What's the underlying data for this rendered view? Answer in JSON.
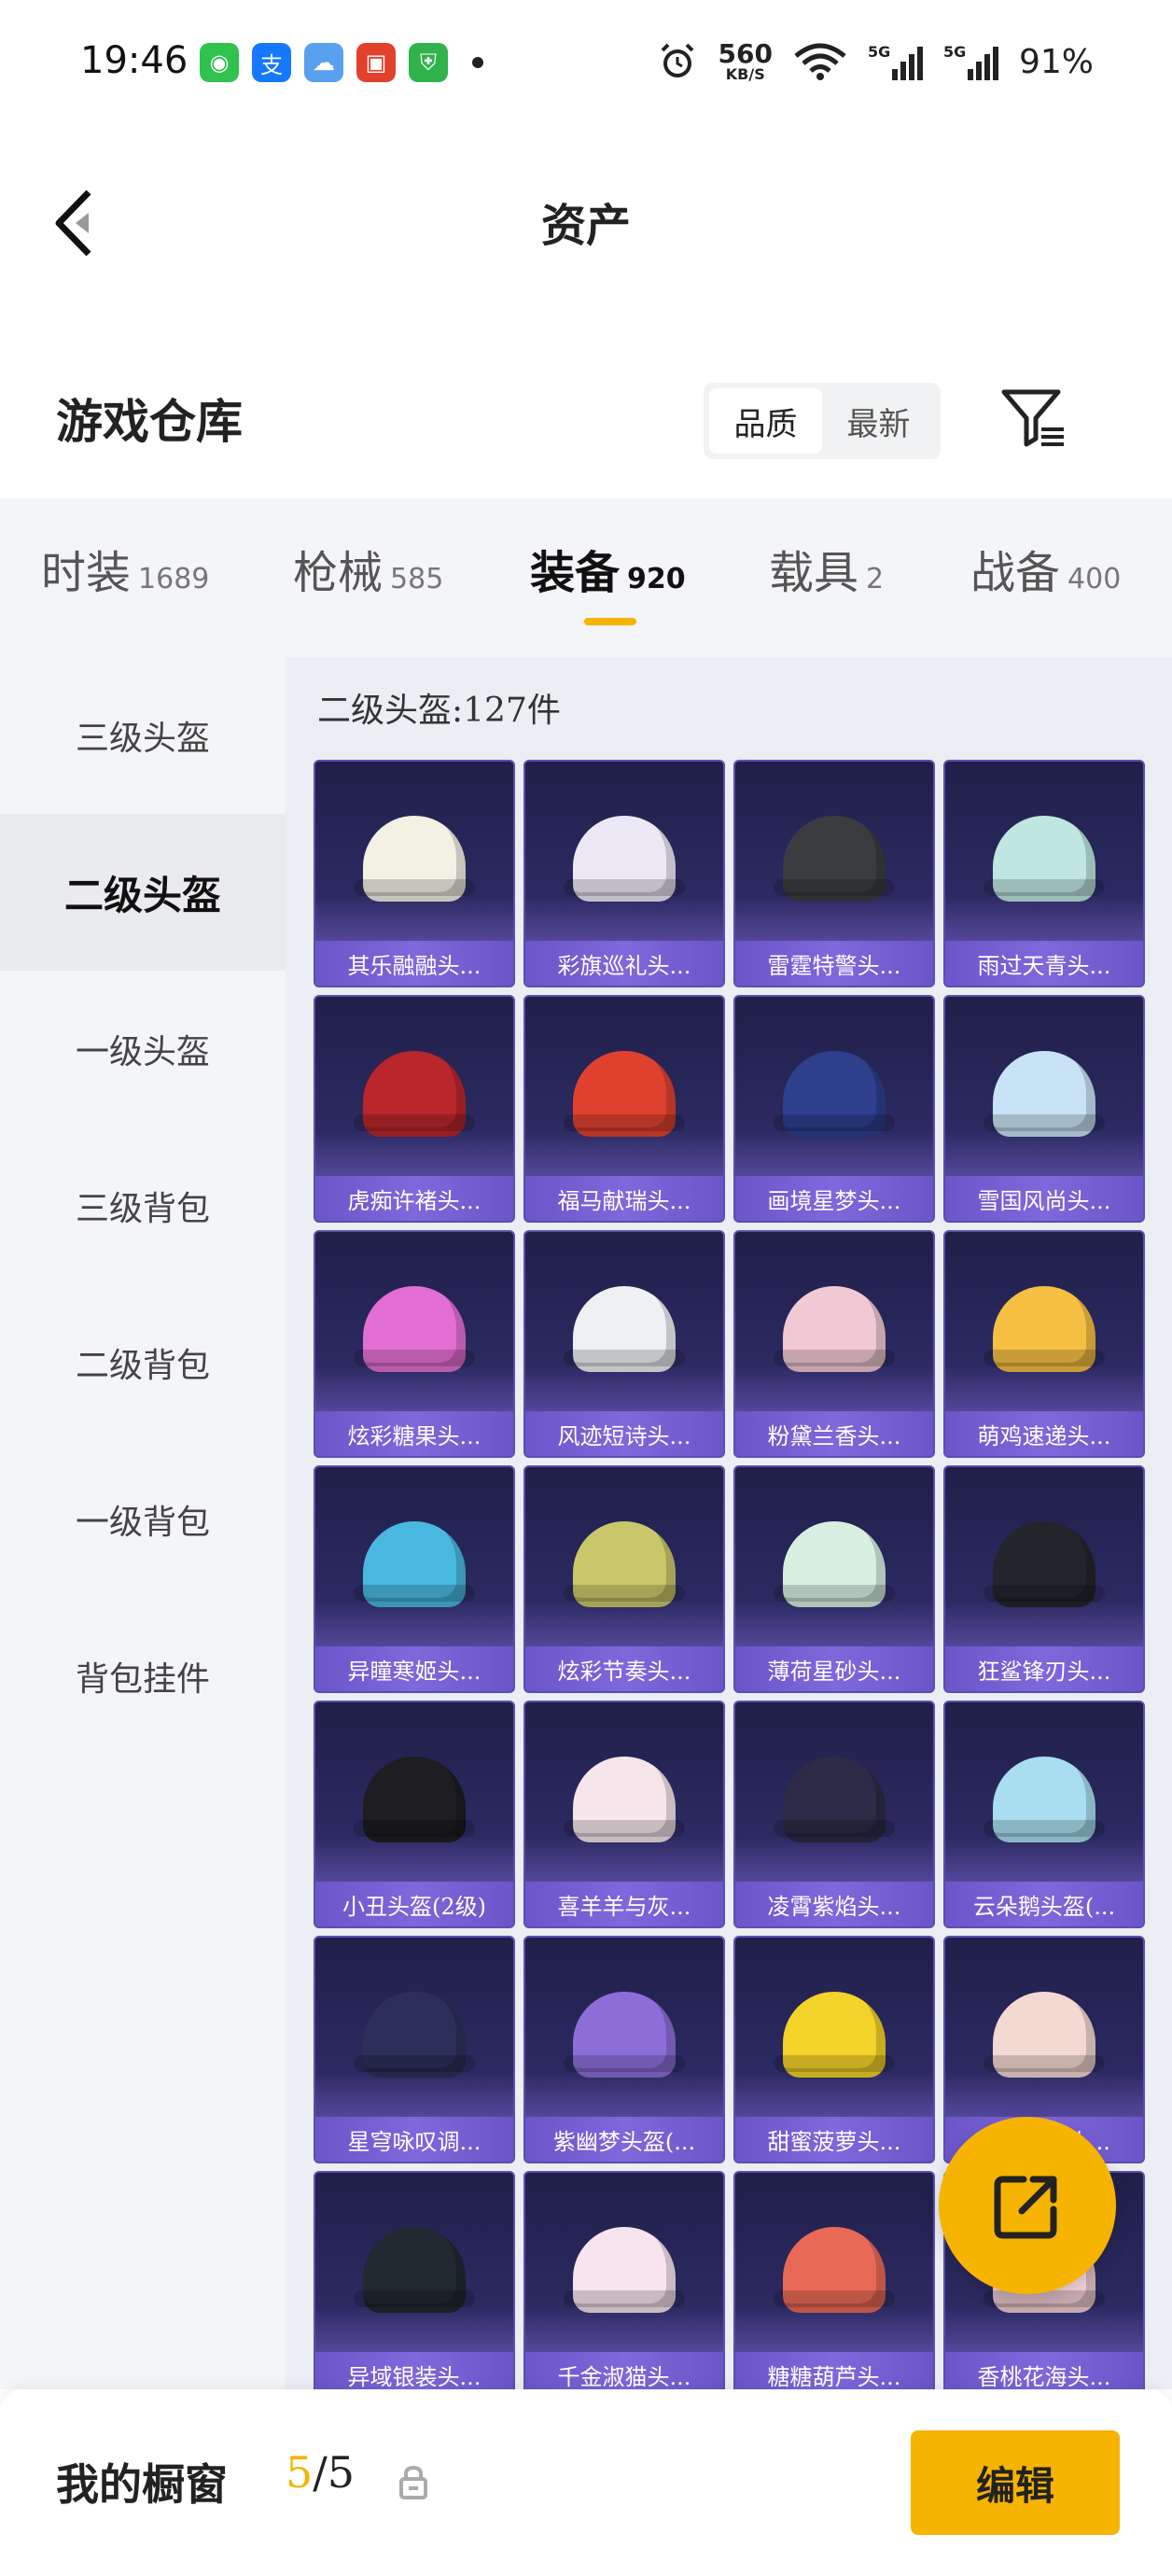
{
  "status_bar": {
    "time": "19:46",
    "apps": [
      {
        "icon": "wechat-icon",
        "glyph": "◉",
        "color": "#2fc24f"
      },
      {
        "icon": "alipay-icon",
        "glyph": "支",
        "color": "#1677ff"
      },
      {
        "icon": "weather-icon",
        "glyph": "☁",
        "color": "#5aa0f0"
      },
      {
        "icon": "game-app-icon",
        "glyph": "▣",
        "color": "#e2412c"
      },
      {
        "icon": "security-shield-icon",
        "glyph": "⛨",
        "color": "#2fb34a"
      }
    ],
    "net_speed": "560",
    "net_unit": "KB/S",
    "signal1": "5G",
    "signal2": "5G",
    "battery": "91%"
  },
  "nav": {
    "title": "资产"
  },
  "header": {
    "title": "游戏仓库",
    "sort_options": [
      "品质",
      "最新"
    ],
    "sort_selected": "品质"
  },
  "categories": [
    {
      "name": "时装",
      "count": "1689"
    },
    {
      "name": "枪械",
      "count": "585"
    },
    {
      "name": "装备",
      "count": "920"
    },
    {
      "name": "载具",
      "count": "2"
    },
    {
      "name": "战备",
      "count": "400"
    }
  ],
  "active_category": "装备",
  "sidebar": [
    {
      "label": "三级头盔"
    },
    {
      "label": "二级头盔"
    },
    {
      "label": "一级头盔"
    },
    {
      "label": "三级背包"
    },
    {
      "label": "二级背包"
    },
    {
      "label": "一级背包"
    },
    {
      "label": "背包挂件"
    }
  ],
  "active_sidebar": "二级头盔",
  "panel": {
    "count_label": "二级头盔:127件"
  },
  "items": [
    {
      "name": "其乐融融头...",
      "color": "#f3f0e4"
    },
    {
      "name": "彩旗巡礼头...",
      "color": "#ece8f6"
    },
    {
      "name": "雷霆特警头...",
      "color": "#3a3c40"
    },
    {
      "name": "雨过天青头...",
      "color": "#bfe6e0"
    },
    {
      "name": "虎痴许褚头...",
      "color": "#b9262b"
    },
    {
      "name": "福马献瑞头...",
      "color": "#e0412f"
    },
    {
      "name": "画境星梦头...",
      "color": "#2e3f8e"
    },
    {
      "name": "雪国风尚头...",
      "color": "#c9e3f6"
    },
    {
      "name": "炫彩糖果头...",
      "color": "#e36fd4"
    },
    {
      "name": "风迹短诗头...",
      "color": "#eef0f4"
    },
    {
      "name": "粉黛兰香头...",
      "color": "#f1c9d4"
    },
    {
      "name": "萌鸡速递头...",
      "color": "#f5bf44"
    },
    {
      "name": "异瞳寒姬头...",
      "color": "#49b8e0"
    },
    {
      "name": "炫彩节奏头...",
      "color": "#c9c76a"
    },
    {
      "name": "薄荷星砂头...",
      "color": "#d8efe2"
    },
    {
      "name": "狂鲨锋刃头...",
      "color": "#23252c"
    },
    {
      "name": "小丑头盔(2级)",
      "color": "#1d1d22"
    },
    {
      "name": "喜羊羊与灰...",
      "color": "#f6e6ec"
    },
    {
      "name": "凌霄紫焰头...",
      "color": "#2c2a46"
    },
    {
      "name": "云朵鹅头盔(...",
      "color": "#a9def0"
    },
    {
      "name": "星穹咏叹调...",
      "color": "#2b2f5a"
    },
    {
      "name": "紫幽梦头盔(...",
      "color": "#8d6ed8"
    },
    {
      "name": "甜蜜菠萝头...",
      "color": "#f3d22a"
    },
    {
      "name": "已日...表头...",
      "color": "#f4d8d2"
    },
    {
      "name": "异域银装头...",
      "color": "#202830"
    },
    {
      "name": "千金淑猫头...",
      "color": "#f7e4ee"
    },
    {
      "name": "糖糖葫芦头...",
      "color": "#e86a56"
    },
    {
      "name": "香桃花海头...",
      "color": "#f3cfd6"
    }
  ],
  "bottom": {
    "label": "我的橱窗",
    "current": "5",
    "total": "/5",
    "edit_label": "编辑"
  },
  "colors": {
    "accent": "#f6b300",
    "card_bg": "#2c2a62",
    "card_label": "#6b55c9"
  }
}
